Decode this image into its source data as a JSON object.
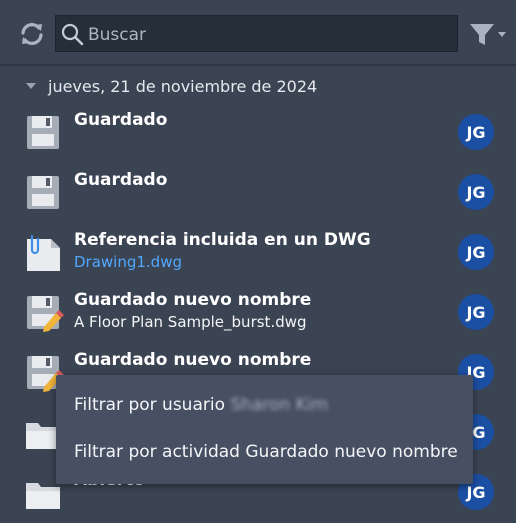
{
  "search": {
    "placeholder": "Buscar",
    "value": ""
  },
  "group": {
    "date": "jueves, 21 de noviembre de 2024"
  },
  "rows": [
    {
      "icon": "save-icon",
      "title": "Guardado",
      "subtitle": "",
      "user": "JG"
    },
    {
      "icon": "save-icon",
      "title": "Guardado",
      "subtitle": "",
      "user": "JG"
    },
    {
      "icon": "attach-document-icon",
      "title": "Referencia incluida en un DWG",
      "subtitle": "Drawing1.dwg",
      "user": "JG"
    },
    {
      "icon": "save-as-icon",
      "title": "Guardado nuevo nombre",
      "subtitle": "A Floor Plan Sample_burst.dwg",
      "user": "JG"
    },
    {
      "icon": "save-as-icon",
      "title": "Guardado nuevo nombre",
      "subtitle": "",
      "user": "JG"
    },
    {
      "icon": "folder-icon",
      "title": "",
      "subtitle": "",
      "user": "JG"
    },
    {
      "icon": "folder-icon",
      "title": "Abierto",
      "subtitle": "",
      "user": "JG"
    }
  ],
  "context_menu": {
    "filter_user_label": "Filtrar por usuario",
    "filter_user_name": "Sharon Kim",
    "filter_activity": "Filtrar por actividad Guardado nuevo nombre"
  },
  "colors": {
    "background": "#3b4453",
    "avatar": "#1b4fa3",
    "link": "#52a8ff",
    "menu": "#465062"
  }
}
